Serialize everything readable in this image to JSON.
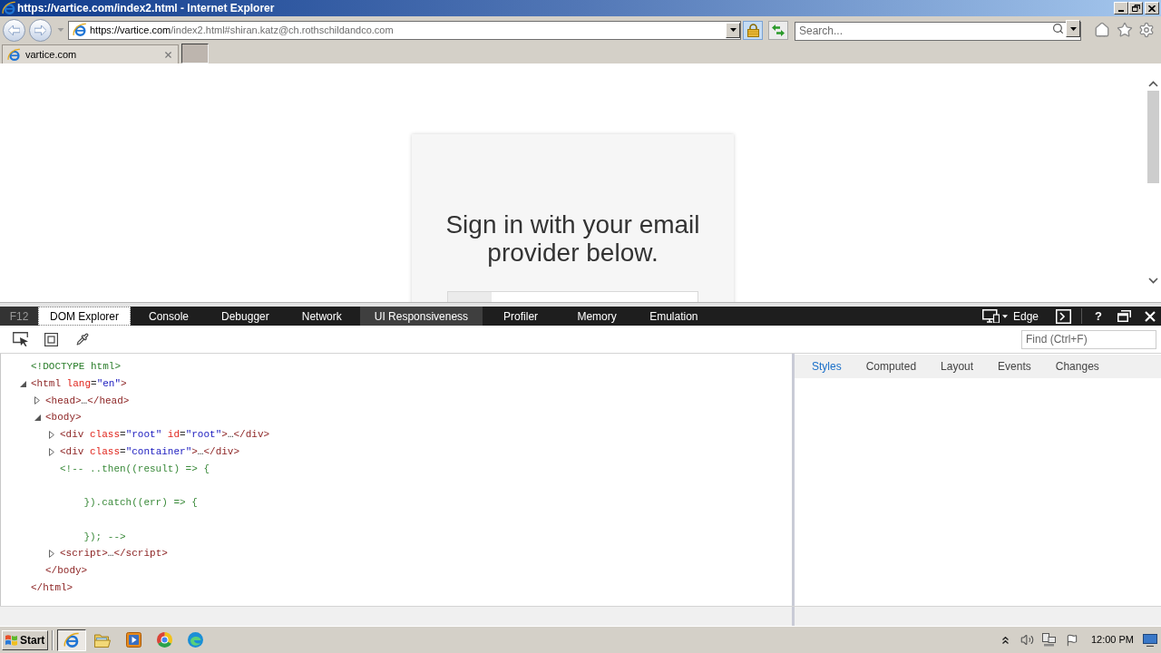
{
  "window": {
    "title": "https://vartice.com/index2.html - Internet Explorer"
  },
  "address_bar": {
    "host": "https://vartice.com",
    "path": "/index2.html#shiran.katz@ch.rothschildandco.com"
  },
  "search": {
    "placeholder": "Search..."
  },
  "tabs": [
    {
      "label": "vartice.com",
      "selected": true
    }
  ],
  "page": {
    "heading": "Sign in with your email provider below."
  },
  "devtools": {
    "f12_label": "F12",
    "tabs": [
      {
        "label": "DOM Explorer",
        "selected": true,
        "hovered": false
      },
      {
        "label": "Console",
        "selected": false,
        "hovered": false
      },
      {
        "label": "Debugger",
        "selected": false,
        "hovered": false
      },
      {
        "label": "Network",
        "selected": false,
        "hovered": false
      },
      {
        "label": "UI Responsiveness",
        "selected": false,
        "hovered": true
      },
      {
        "label": "Profiler",
        "selected": false,
        "hovered": false
      },
      {
        "label": "Memory",
        "selected": false,
        "hovered": false
      },
      {
        "label": "Emulation",
        "selected": false,
        "hovered": false
      }
    ],
    "emulation_mode": "Edge",
    "help_label": "?",
    "find": {
      "placeholder": "Find (Ctrl+F)"
    },
    "dom_tree": [
      {
        "open": [
          {
            "kind": "doctype",
            "text": "<!DOCTYPE html>"
          }
        ]
      },
      {
        "open": [
          {
            "kind": "tag",
            "text": "<html"
          },
          {
            "kind": "attr",
            "text": " lang"
          },
          {
            "kind": "punct",
            "text": "="
          },
          {
            "kind": "value",
            "text": "\"en\""
          },
          {
            "kind": "tag",
            "text": ">"
          }
        ],
        "expanded": true,
        "children": [
          {
            "open": [
              {
                "kind": "tag",
                "text": "<head>"
              },
              {
                "kind": "punct",
                "text": "…"
              },
              {
                "kind": "tag",
                "text": "</head>"
              }
            ],
            "expanded": false
          },
          {
            "open": [
              {
                "kind": "tag",
                "text": "<body>"
              }
            ],
            "expanded": true,
            "children": [
              {
                "open": [
                  {
                    "kind": "tag",
                    "text": "<div"
                  },
                  {
                    "kind": "attr",
                    "text": " class"
                  },
                  {
                    "kind": "punct",
                    "text": "="
                  },
                  {
                    "kind": "value",
                    "text": "\"root\""
                  },
                  {
                    "kind": "attr",
                    "text": " id"
                  },
                  {
                    "kind": "punct",
                    "text": "="
                  },
                  {
                    "kind": "value",
                    "text": "\"root\""
                  },
                  {
                    "kind": "tag",
                    "text": ">"
                  },
                  {
                    "kind": "punct",
                    "text": "…"
                  },
                  {
                    "kind": "tag",
                    "text": "</div>"
                  }
                ],
                "expanded": false
              },
              {
                "open": [
                  {
                    "kind": "tag",
                    "text": "<div"
                  },
                  {
                    "kind": "attr",
                    "text": " class"
                  },
                  {
                    "kind": "punct",
                    "text": "="
                  },
                  {
                    "kind": "value",
                    "text": "\"container\""
                  },
                  {
                    "kind": "tag",
                    "text": ">"
                  },
                  {
                    "kind": "punct",
                    "text": "…"
                  },
                  {
                    "kind": "tag",
                    "text": "</div>"
                  }
                ],
                "expanded": false
              },
              {
                "open": [
                  {
                    "kind": "comment",
                    "text": "<!-- ..then((result) => {\n\n    }).catch((err) => {\n\n    }); -->"
                  }
                ]
              },
              {
                "open": [
                  {
                    "kind": "tag",
                    "text": "<script>"
                  },
                  {
                    "kind": "punct",
                    "text": "…"
                  },
                  {
                    "kind": "tag",
                    "text": "</script>"
                  }
                ],
                "expanded": false
              }
            ],
            "close": [
              {
                "kind": "tag",
                "text": "</body>"
              }
            ]
          }
        ],
        "close": [
          {
            "kind": "tag",
            "text": "</html>"
          }
        ]
      }
    ],
    "side_tabs": [
      {
        "label": "Styles",
        "selected": true
      },
      {
        "label": "Computed",
        "selected": false
      },
      {
        "label": "Layout",
        "selected": false
      },
      {
        "label": "Events",
        "selected": false
      },
      {
        "label": "Changes",
        "selected": false
      }
    ]
  },
  "taskbar": {
    "start_label": "Start",
    "apps": [
      {
        "kind": "e-logo",
        "selected": true
      },
      {
        "kind": "folder",
        "selected": false
      },
      {
        "kind": "player",
        "selected": false
      },
      {
        "kind": "wheel",
        "selected": false
      },
      {
        "kind": "wave",
        "selected": false
      }
    ],
    "clock": "12:00 PM"
  }
}
